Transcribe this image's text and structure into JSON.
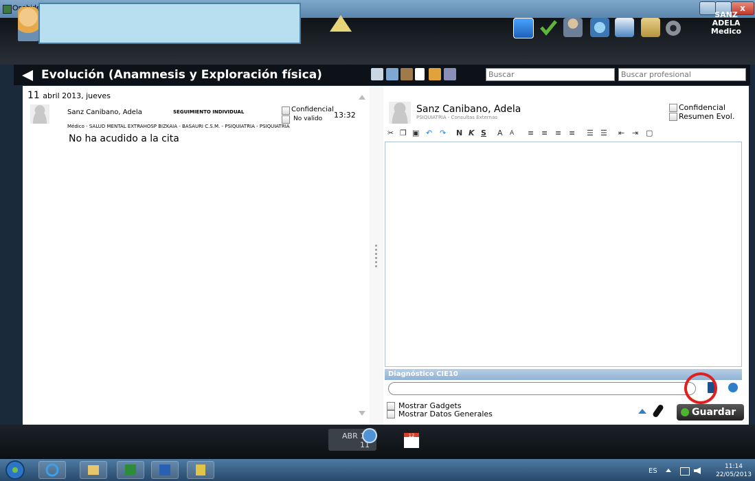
{
  "window": {
    "title": "OsabideGlobal - 1.41.2 -",
    "close_glyph": "x"
  },
  "header": {
    "user_line1": "SANZ",
    "user_line2": "ADELA",
    "user_line3": "Medico"
  },
  "module": {
    "title": "Evolución (Anamnesis y Exploración física)"
  },
  "search": {
    "placeholder": "Buscar",
    "professional_placeholder": "Buscar profesional"
  },
  "left": {
    "date_day": "11",
    "date_rest": "abril 2013, jueves",
    "entry": {
      "author": "Sanz Canibano, Adela",
      "type": "SEGUIMIENTO INDIVIDUAL",
      "confidential_label": "Confidencial",
      "not_valid_label": "No valido",
      "time": "13:32",
      "department": "Médico - SALUD MENTAL EXTRAHOSP BIZKAIA - BASAURI C.S.M. - PSIQUIATRIA - PSIQUIATRIA",
      "text": "No ha acudido a la cita"
    }
  },
  "right": {
    "author": "Sanz Canibano, Adela",
    "department": "PSIQUIATRIA - Consultas Externas",
    "confidential_label": "Confidencial",
    "summary_label": "Resumen Evol.",
    "toolbar": {
      "bold": "N",
      "italic": "K",
      "underline": "S",
      "font_up": "A",
      "font_down": "A"
    },
    "diagnosis_label": "Diagnóstico CIE10",
    "show_gadgets": "Mostrar Gadgets",
    "show_general": "Mostrar Datos Generales",
    "save_label": "Guardar"
  },
  "bottom": {
    "month": "ABR 13",
    "day": "11",
    "calendar_day": "12"
  },
  "tray": {
    "lang": "ES",
    "time": "11:14",
    "date": "22/05/2013"
  },
  "icons": {
    "taskbar": [
      "ie-icon",
      "explorer-icon",
      "excel-icon",
      "word-icon",
      "app-icon"
    ],
    "header": [
      "s-icon",
      "check-icon",
      "doctor-icon",
      "globe-icon",
      "card-icon",
      "folder-icon",
      "gear-icon"
    ]
  },
  "colors": {
    "accent": "#2f7fc8",
    "highlight_circle": "#e01f1f",
    "patient_box": "#b7dff0"
  }
}
